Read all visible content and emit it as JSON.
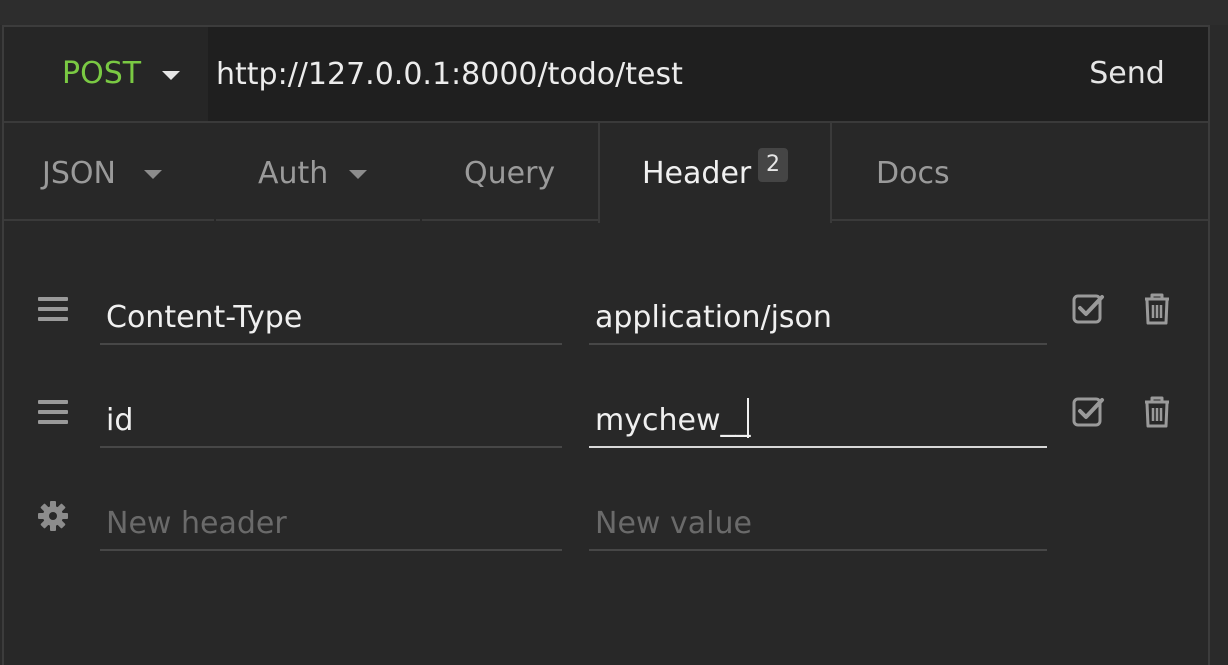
{
  "request": {
    "method": "POST",
    "url": "http://127.0.0.1:8000/todo/test",
    "send_label": "Send"
  },
  "tabs": [
    {
      "label": "JSON",
      "has_dropdown": true
    },
    {
      "label": "Auth",
      "has_dropdown": true
    },
    {
      "label": "Query",
      "has_dropdown": false
    },
    {
      "label": "Header",
      "badge": "2",
      "active": true
    },
    {
      "label": "Docs",
      "has_dropdown": false
    }
  ],
  "headers": [
    {
      "name": "Content-Type",
      "value": "application/json",
      "enabled": true
    },
    {
      "name": "id",
      "value": "mychew__",
      "enabled": true
    }
  ],
  "new_header": {
    "name_placeholder": "New header",
    "value_placeholder": "New value"
  },
  "colors": {
    "method_post": "#7ac943",
    "background": "#282828",
    "url_bar": "#1f1f1f"
  },
  "icons": {
    "drag_handle": "bars-icon",
    "enabled": "checkbox-checked-icon",
    "delete": "trash-icon",
    "settings": "gear-icon",
    "dropdown": "caret-down-icon"
  }
}
